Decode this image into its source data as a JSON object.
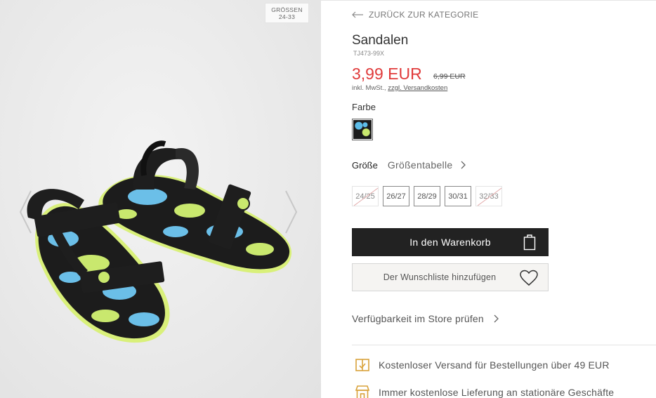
{
  "gallery": {
    "size_badge_line1": "GRÖSSEN",
    "size_badge_line2": "24-33",
    "prev_icon": "chevron-left-icon",
    "next_icon": "chevron-right-icon"
  },
  "product": {
    "back_link": "ZURÜCK ZUR KATEGORIE",
    "title": "Sandalen",
    "sku": "TJ473-99X",
    "price": "3,99 EUR",
    "old_price": "6,99 EUR",
    "tax_prefix": "inkl. MwSt., ",
    "tax_link": "zzgl. Versandkosten",
    "color_label": "Farbe",
    "size_label": "Größe",
    "size_chart_link": "Größentabelle",
    "sizes": [
      {
        "label": "24/25",
        "available": false
      },
      {
        "label": "26/27",
        "available": true
      },
      {
        "label": "28/29",
        "available": true
      },
      {
        "label": "30/31",
        "available": true
      },
      {
        "label": "32/33",
        "available": false
      }
    ],
    "add_to_cart": "In den Warenkorb",
    "add_to_wishlist": "Der Wunschliste hinzufügen",
    "store_availability": "Verfügbarkeit im Store prüfen",
    "benefits": [
      {
        "icon": "shipping-box-icon",
        "text": "Kostenloser Versand für Bestellungen über 49 EUR"
      },
      {
        "icon": "store-icon",
        "text": "Immer kostenlose Lieferung an stationäre Geschäfte"
      }
    ]
  },
  "colors": {
    "accent_price": "#e03a3a",
    "button_dark": "#222222",
    "benefit_icon": "#d9a23a"
  }
}
